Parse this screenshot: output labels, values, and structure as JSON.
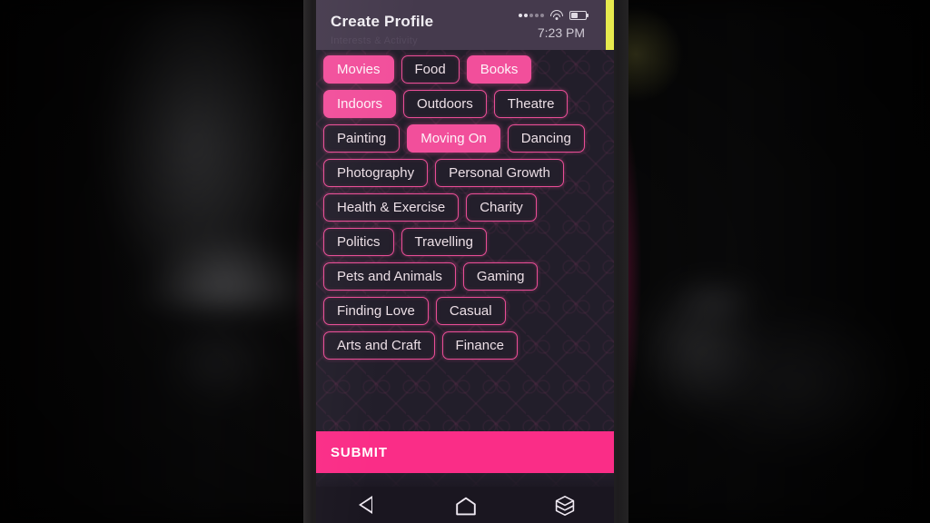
{
  "app": {
    "header_title": "Create Profile",
    "ghost_text": "Interests & Activity",
    "accent_pink": "#f24f9b",
    "submit_pink": "#fa2d87",
    "header_bg": "#453a4d",
    "screen_bg": "#221e2a",
    "edge_accent": "#e7ea4e"
  },
  "status_bar": {
    "time": "7:23 PM",
    "signal_dots_total": 5,
    "signal_dots_filled": 2,
    "wifi_icon": "wifi-icon",
    "battery_icon": "battery-icon",
    "battery_level_percent": 40
  },
  "chips": [
    {
      "label": "Movies",
      "selected": true
    },
    {
      "label": "Food",
      "selected": false
    },
    {
      "label": "Books",
      "selected": true
    },
    {
      "label": "Indoors",
      "selected": true
    },
    {
      "label": "Outdoors",
      "selected": false
    },
    {
      "label": "Theatre",
      "selected": false
    },
    {
      "label": "Painting",
      "selected": false
    },
    {
      "label": "Moving On",
      "selected": true
    },
    {
      "label": "Dancing",
      "selected": false
    },
    {
      "label": "Photography",
      "selected": false
    },
    {
      "label": "Personal Growth",
      "selected": false
    },
    {
      "label": "Health & Exercise",
      "selected": false
    },
    {
      "label": "Charity",
      "selected": false
    },
    {
      "label": "Politics",
      "selected": false
    },
    {
      "label": "Travelling",
      "selected": false
    },
    {
      "label": "Pets and Animals",
      "selected": false
    },
    {
      "label": "Gaming",
      "selected": false
    },
    {
      "label": "Finding Love",
      "selected": false
    },
    {
      "label": "Casual",
      "selected": false
    },
    {
      "label": "Arts and Craft",
      "selected": false
    },
    {
      "label": "Finance",
      "selected": false
    }
  ],
  "submit": {
    "label": "SUBMIT"
  },
  "nav_bar": {
    "back_icon": "back-triangle-icon",
    "home_icon": "home-icon",
    "recents_icon": "recents-hexagon-icon"
  }
}
